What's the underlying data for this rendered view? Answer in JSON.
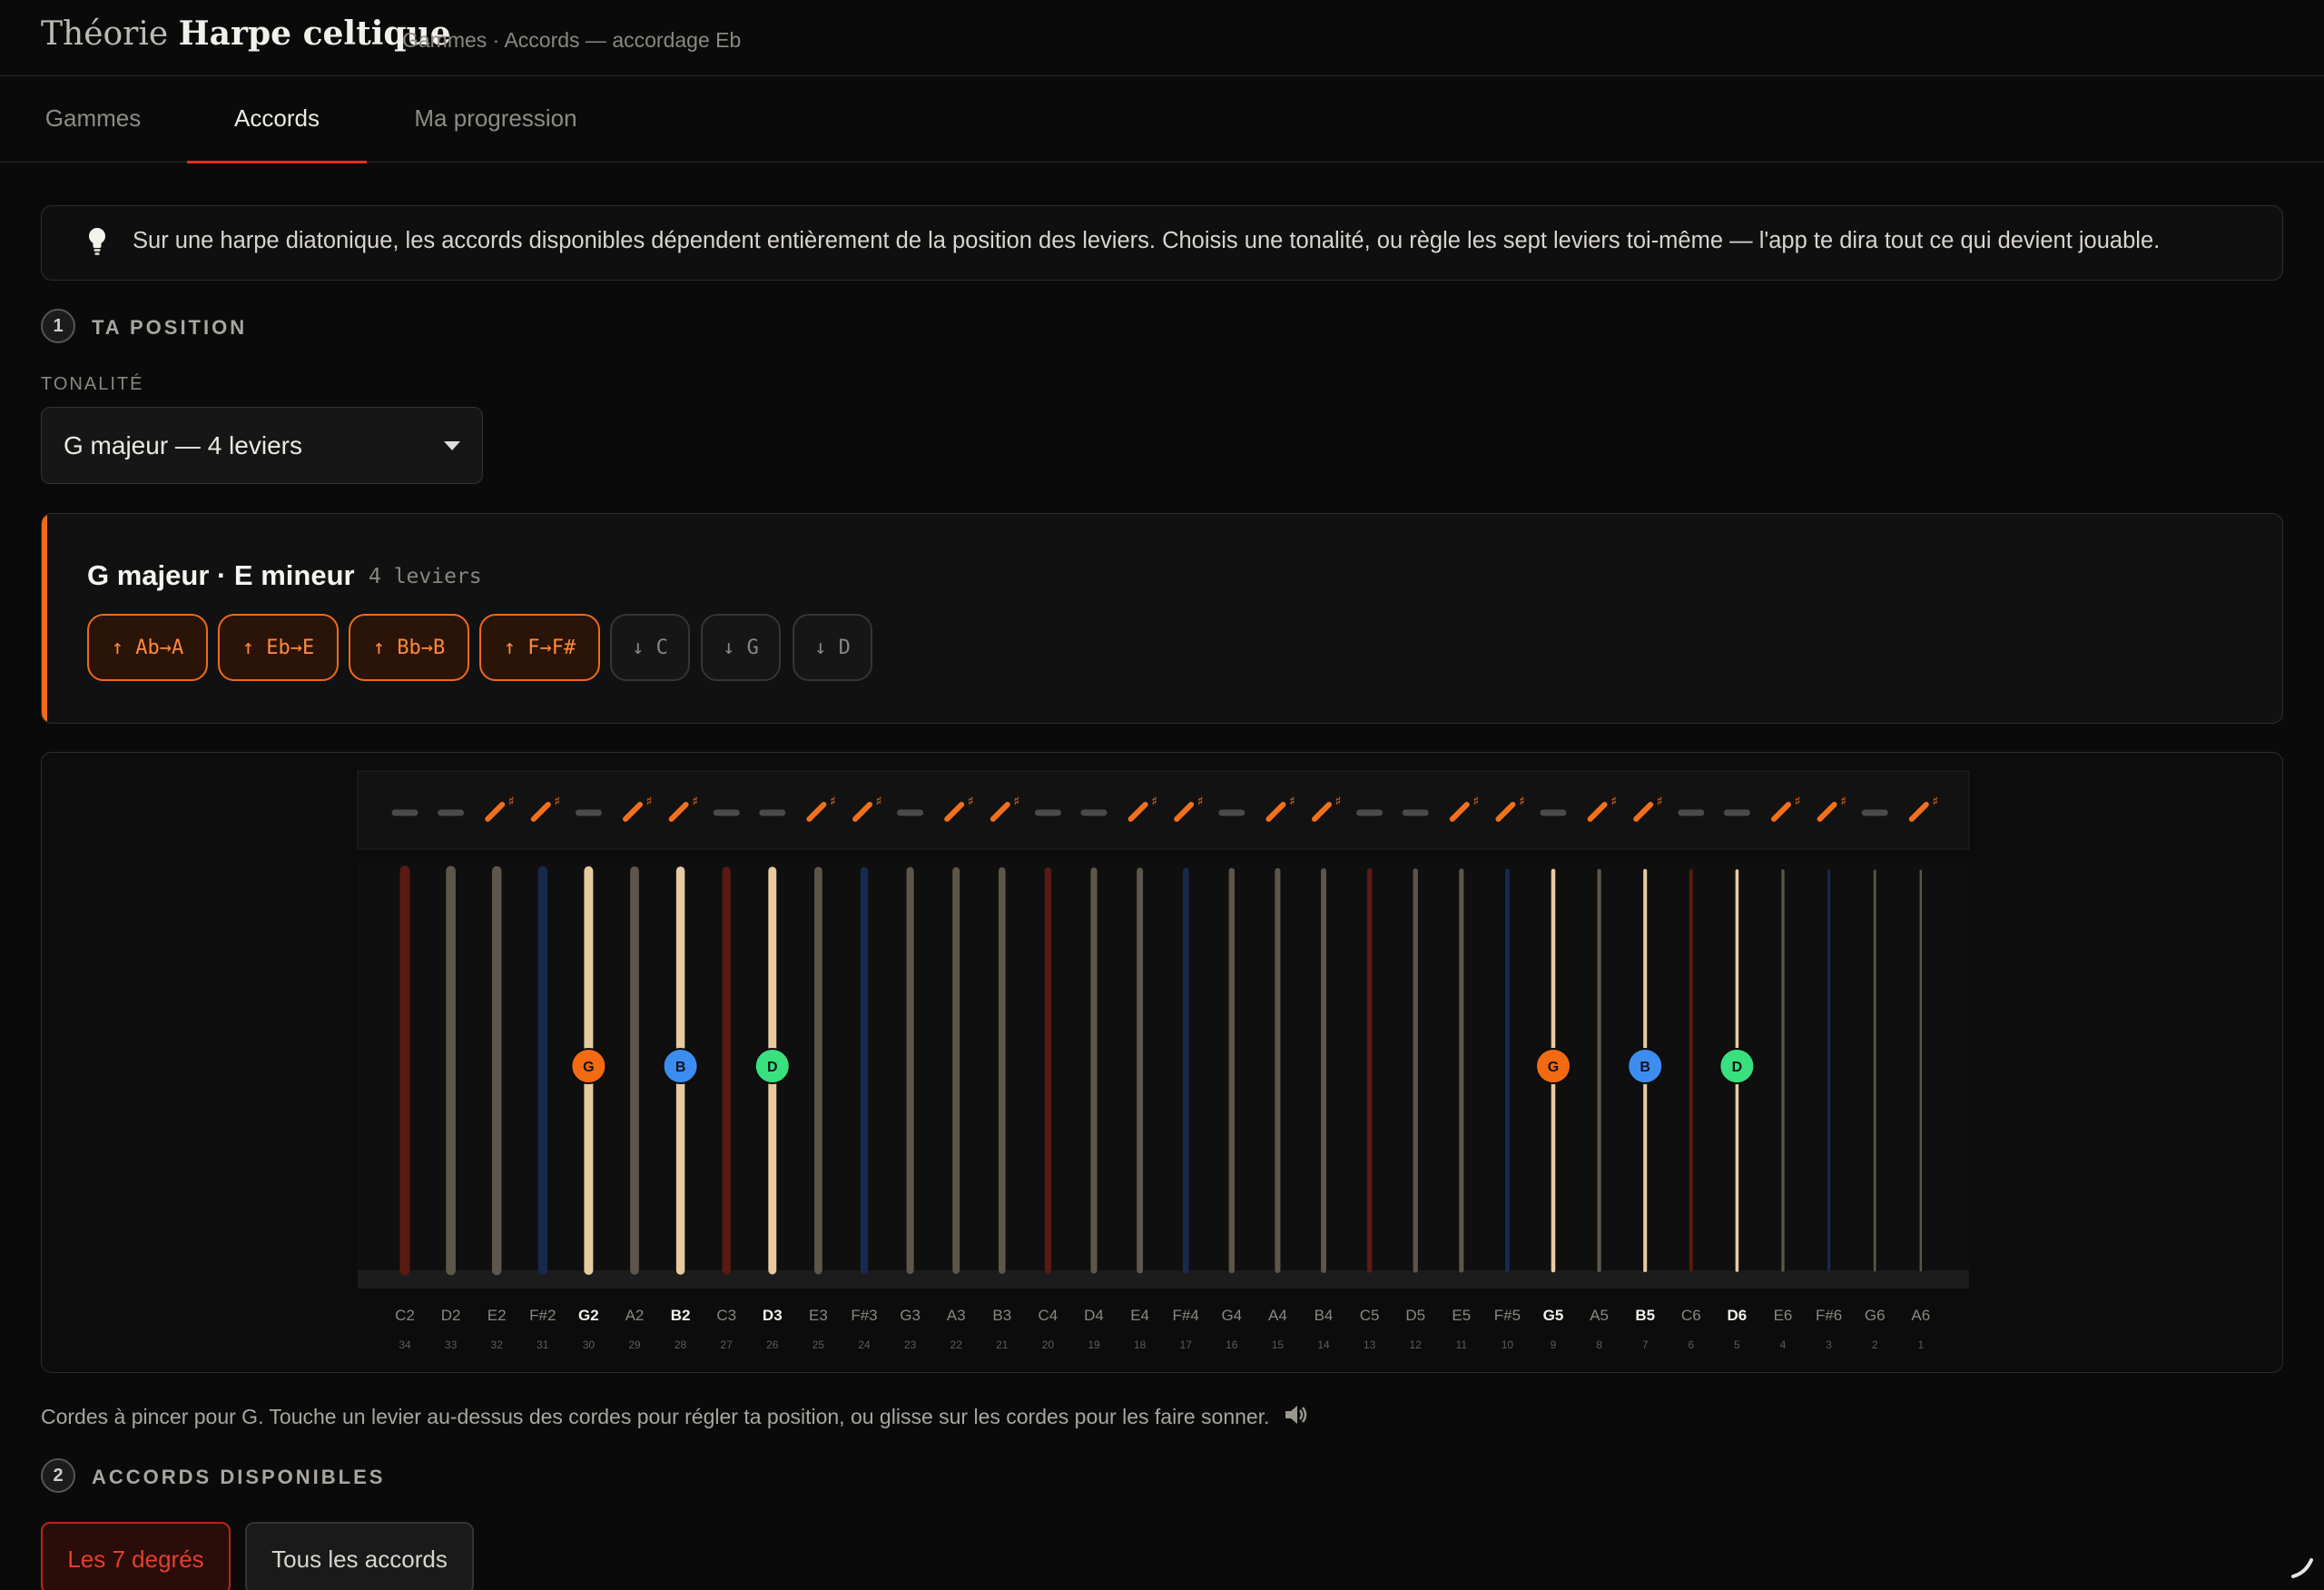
{
  "header": {
    "title_light": "Théorie",
    "title_bold": "Harpe celtique",
    "subtitle": "Gammes · Accords — accordage Eb"
  },
  "tabs": [
    {
      "label": "Gammes",
      "active": false
    },
    {
      "label": "Accords",
      "active": true
    },
    {
      "label": "Ma progression",
      "active": false
    }
  ],
  "tip": {
    "icon": "lightbulb-icon",
    "text": "Sur une harpe diatonique, les accords disponibles dépendent entièrement de la position des leviers. Choisis une tonalité, ou règle les sept leviers toi-même — l'app te dira tout ce qui devient jouable."
  },
  "step1": {
    "number": "1",
    "label": "TA POSITION"
  },
  "tonality": {
    "label": "TONALITÉ",
    "selected": "G majeur — 4 leviers"
  },
  "key_card": {
    "title": "G majeur · E mineur",
    "count": "4 leviers",
    "chips": [
      {
        "label": "↑ Ab→A",
        "raised": true
      },
      {
        "label": "↑ Eb→E",
        "raised": true
      },
      {
        "label": "↑ Bb→B",
        "raised": true
      },
      {
        "label": "↑ F→F#",
        "raised": true
      },
      {
        "label": "↓ C",
        "raised": false
      },
      {
        "label": "↓ G",
        "raised": false
      },
      {
        "label": "↓ D",
        "raised": false
      }
    ]
  },
  "harp": {
    "colors": {
      "red": "#5a1a12",
      "blue": "#172a4e",
      "gut": "#5e554b",
      "lit": "#e8caa0",
      "lever": "#f2701c",
      "lever_off": "#4a4a4a"
    },
    "strings": [
      {
        "name": "C2",
        "num": "34",
        "type": "red",
        "lever": false
      },
      {
        "name": "D2",
        "num": "33",
        "type": "gut",
        "lever": false
      },
      {
        "name": "E2",
        "num": "32",
        "type": "gut",
        "lever": true
      },
      {
        "name": "F#2",
        "num": "31",
        "type": "blue",
        "lever": true
      },
      {
        "name": "G2",
        "num": "30",
        "type": "gut",
        "lever": false,
        "chord": "G",
        "bold": true
      },
      {
        "name": "A2",
        "num": "29",
        "type": "gut",
        "lever": true
      },
      {
        "name": "B2",
        "num": "28",
        "type": "gut",
        "lever": true,
        "chord": "B",
        "bold": true
      },
      {
        "name": "C3",
        "num": "27",
        "type": "red",
        "lever": false
      },
      {
        "name": "D3",
        "num": "26",
        "type": "gut",
        "lever": false,
        "chord": "D",
        "bold": true
      },
      {
        "name": "E3",
        "num": "25",
        "type": "gut",
        "lever": true
      },
      {
        "name": "F#3",
        "num": "24",
        "type": "blue",
        "lever": true
      },
      {
        "name": "G3",
        "num": "23",
        "type": "gut",
        "lever": false
      },
      {
        "name": "A3",
        "num": "22",
        "type": "gut",
        "lever": true
      },
      {
        "name": "B3",
        "num": "21",
        "type": "gut",
        "lever": true
      },
      {
        "name": "C4",
        "num": "20",
        "type": "red",
        "lever": false
      },
      {
        "name": "D4",
        "num": "19",
        "type": "gut",
        "lever": false
      },
      {
        "name": "E4",
        "num": "18",
        "type": "gut",
        "lever": true
      },
      {
        "name": "F#4",
        "num": "17",
        "type": "blue",
        "lever": true
      },
      {
        "name": "G4",
        "num": "16",
        "type": "gut",
        "lever": false
      },
      {
        "name": "A4",
        "num": "15",
        "type": "gut",
        "lever": true
      },
      {
        "name": "B4",
        "num": "14",
        "type": "gut",
        "lever": true
      },
      {
        "name": "C5",
        "num": "13",
        "type": "red",
        "lever": false
      },
      {
        "name": "D5",
        "num": "12",
        "type": "gut",
        "lever": false
      },
      {
        "name": "E5",
        "num": "11",
        "type": "gut",
        "lever": true
      },
      {
        "name": "F#5",
        "num": "10",
        "type": "blue",
        "lever": true
      },
      {
        "name": "G5",
        "num": "9",
        "type": "gut",
        "lever": false,
        "chord": "G",
        "bold": true
      },
      {
        "name": "A5",
        "num": "8",
        "type": "gut",
        "lever": true
      },
      {
        "name": "B5",
        "num": "7",
        "type": "gut",
        "lever": true,
        "chord": "B",
        "bold": true
      },
      {
        "name": "C6",
        "num": "6",
        "type": "red",
        "lever": false
      },
      {
        "name": "D6",
        "num": "5",
        "type": "gut",
        "lever": false,
        "chord": "D",
        "bold": true
      },
      {
        "name": "E6",
        "num": "4",
        "type": "gut",
        "lever": true
      },
      {
        "name": "F#6",
        "num": "3",
        "type": "blue",
        "lever": true
      },
      {
        "name": "G6",
        "num": "2",
        "type": "gut",
        "lever": false
      },
      {
        "name": "A6",
        "num": "1",
        "type": "gut",
        "lever": true
      }
    ],
    "chord_colors": {
      "G": "#f26a12",
      "B": "#3d8df0",
      "D": "#39e07e"
    }
  },
  "caption": {
    "text": "Cordes à pincer pour G. Touche un levier au-dessus des cordes pour régler ta position, ou glisse sur les cordes pour les faire sonner.",
    "icon": "speaker-icon"
  },
  "step2": {
    "number": "2",
    "label": "ACCORDS DISPONIBLES"
  },
  "filters": [
    {
      "label": "Les 7 degrés",
      "active": true
    },
    {
      "label": "Tous les accords",
      "active": false
    }
  ]
}
